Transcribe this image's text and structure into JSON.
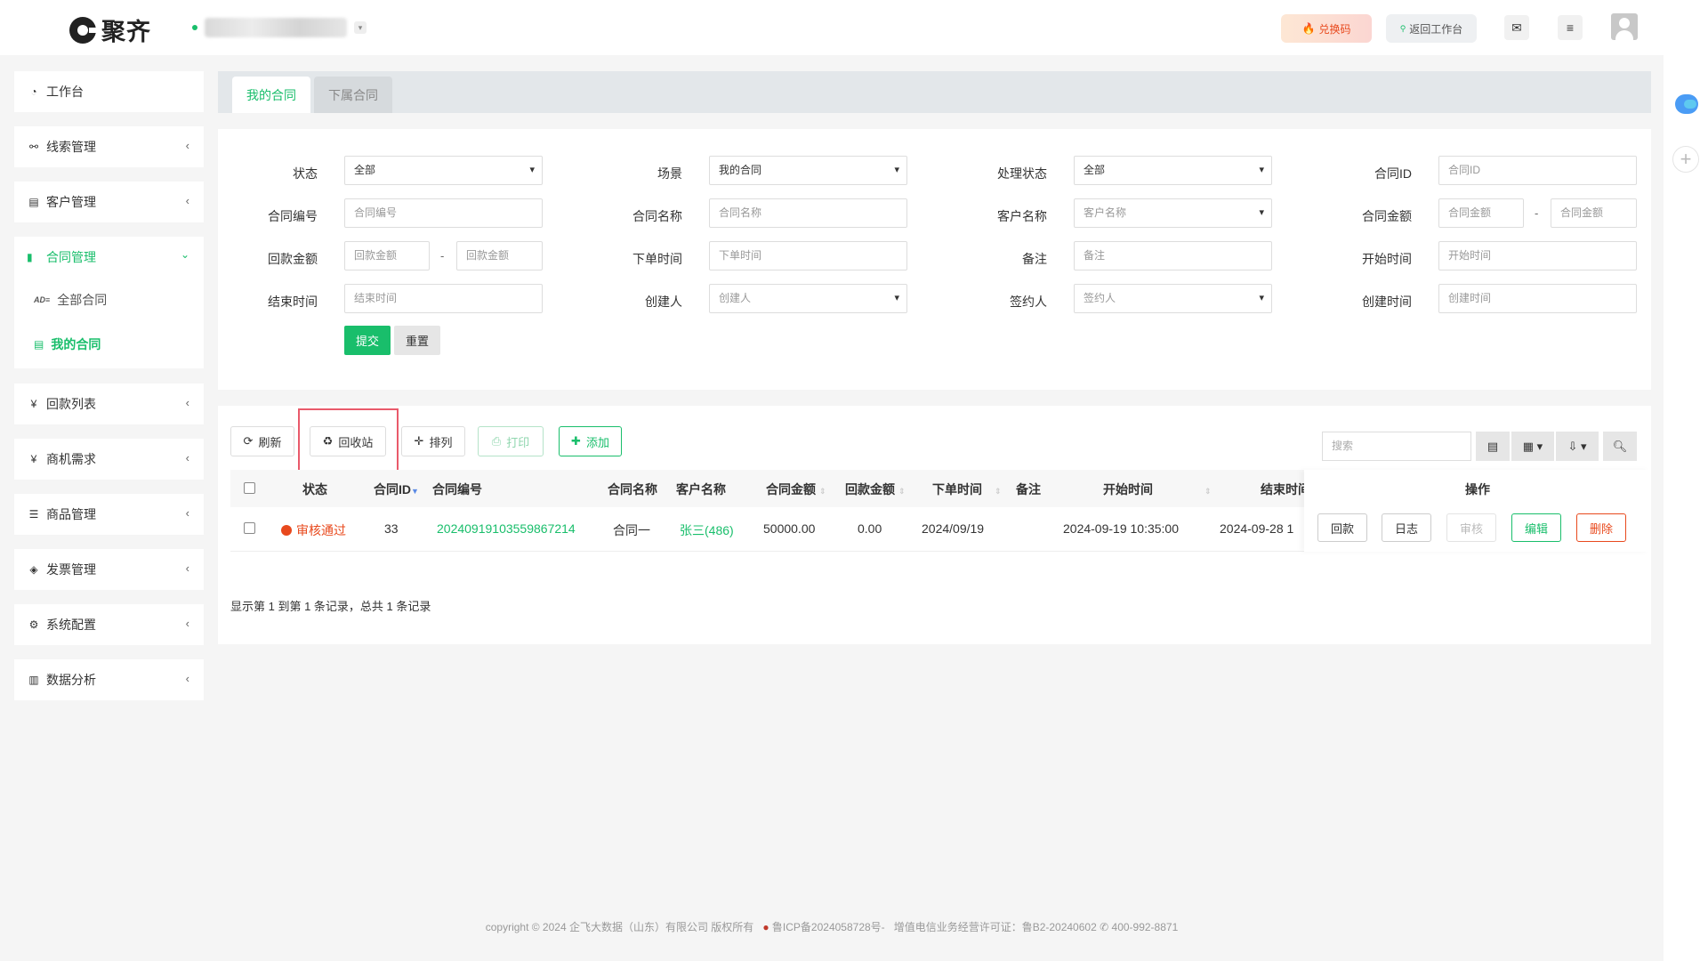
{
  "header": {
    "logo_text": "聚齐",
    "redeem_label": "兑换码",
    "back_label": "返回工作台"
  },
  "sidebar": {
    "workbench": "工作台",
    "leads": "线索管理",
    "customers": "客户管理",
    "contracts": "合同管理",
    "contracts_all": "全部合同",
    "contracts_mine": "我的合同",
    "payments": "回款列表",
    "opportunities": "商机需求",
    "products": "商品管理",
    "invoices": "发票管理",
    "system": "系统配置",
    "analytics": "数据分析"
  },
  "tabs": {
    "mine": "我的合同",
    "subordinate": "下属合同"
  },
  "filters": {
    "status_label": "状态",
    "status_value": "全部",
    "scene_label": "场景",
    "scene_value": "我的合同",
    "process_label": "处理状态",
    "process_value": "全部",
    "contract_id_label": "合同ID",
    "contract_id_ph": "合同ID",
    "contract_no_label": "合同编号",
    "contract_no_ph": "合同编号",
    "contract_name_label": "合同名称",
    "contract_name_ph": "合同名称",
    "customer_label": "客户名称",
    "customer_ph": "客户名称",
    "amount_label": "合同金额",
    "amount_ph": "合同金额",
    "payment_label": "回款金额",
    "payment_ph": "回款金额",
    "order_time_label": "下单时间",
    "order_time_ph": "下单时间",
    "remark_label": "备注",
    "remark_ph": "备注",
    "start_label": "开始时间",
    "start_ph": "开始时间",
    "end_label": "结束时间",
    "end_ph": "结束时间",
    "creator_label": "创建人",
    "creator_ph": "创建人",
    "signer_label": "签约人",
    "signer_ph": "签约人",
    "created_label": "创建时间",
    "created_ph": "创建时间",
    "dash": "-",
    "submit": "提交",
    "reset": "重置"
  },
  "toolbar": {
    "refresh": "刷新",
    "recycle": "回收站",
    "arrange": "排列",
    "print": "打印",
    "add": "添加",
    "search_ph": "搜索"
  },
  "table": {
    "columns": [
      "状态",
      "合同ID",
      "合同编号",
      "合同名称",
      "客户名称",
      "合同金额",
      "回款金额",
      "下单时间",
      "备注",
      "开始时间",
      "结束时间",
      "操作"
    ],
    "rows": [
      {
        "status": "审核通过",
        "id": "33",
        "number": "20240919103559867214",
        "name": "合同一",
        "customer": "张三(486)",
        "amount": "50000.00",
        "payment": "0.00",
        "order_time": "2024/09/19",
        "remark": "",
        "start_time": "2024-09-19 10:35:00",
        "end_time": "2024-09-28 1"
      }
    ],
    "ops": {
      "payment": "回款",
      "log": "日志",
      "audit": "审核",
      "edit": "编辑",
      "delete": "删除"
    },
    "pager": "显示第 1 到第 1 条记录，总共 1 条记录"
  },
  "footer": {
    "copyright": "copyright © 2024 企飞大数据（山东）有限公司 版权所有",
    "icp": "鲁ICP备2024058728号-",
    "license": "增值电信业务经营许可证：鲁B2-20240602",
    "phone": "400-992-8871"
  },
  "colors": {
    "accent": "#19be6b",
    "danger": "#e8491d",
    "highlight": "#e95a6b"
  }
}
